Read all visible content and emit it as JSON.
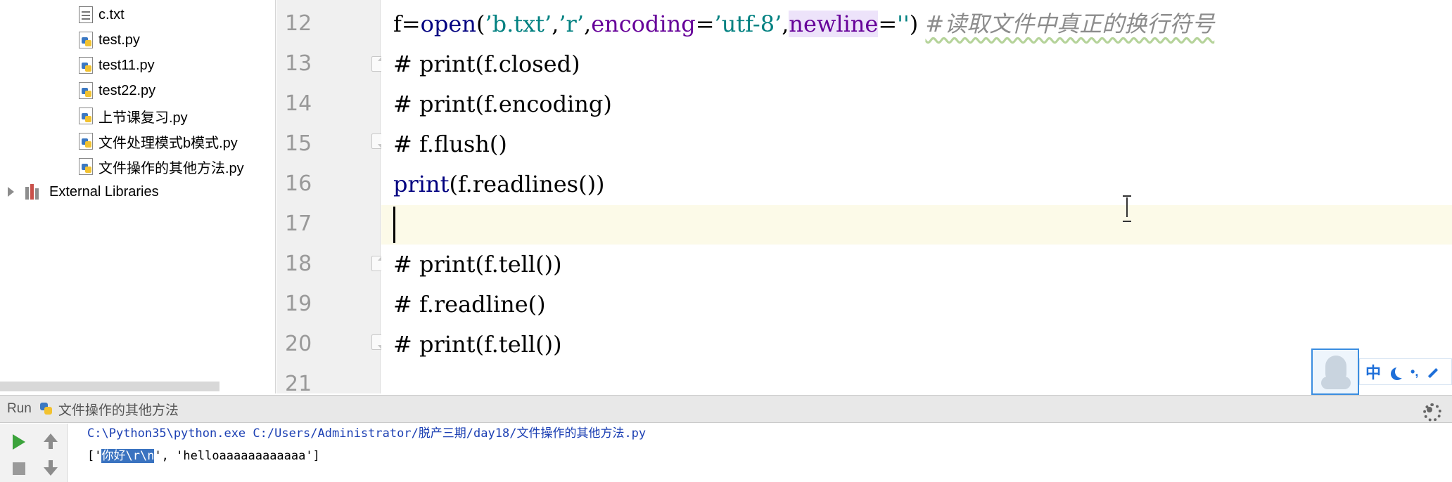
{
  "project_tree": {
    "files": [
      {
        "name": "c.txt",
        "type": "txt"
      },
      {
        "name": "test.py",
        "type": "py"
      },
      {
        "name": "test11.py",
        "type": "py"
      },
      {
        "name": "test22.py",
        "type": "py"
      },
      {
        "name": "上节课复习.py",
        "type": "py"
      },
      {
        "name": "文件处理模式b模式.py",
        "type": "py"
      },
      {
        "name": "文件操作的其他方法.py",
        "type": "py"
      }
    ],
    "external_libraries": "External Libraries"
  },
  "editor": {
    "line_numbers": [
      "12",
      "13",
      "14",
      "15",
      "16",
      "17",
      "18",
      "19",
      "20",
      "21"
    ],
    "current_line": "17",
    "lines": {
      "l12": {
        "f_eq": "f=",
        "open": "open",
        "p1": "(",
        "s1": "’b.txt’",
        "c1": ",",
        "s2": "’r’",
        "c2": ",",
        "kw1": "encoding",
        "eq1": "=",
        "s3": "’utf-8’",
        "c3": ",",
        "kw2": "newline",
        "eq2": "=",
        "s4": "''",
        "p2": ")",
        "comment": "#读取文件中真正的换行符号"
      },
      "l13": "# print(f.closed)",
      "l14": "# print(f.encoding)",
      "l15": "# f.flush()",
      "l16": {
        "print": "print",
        "rest": "(f.readlines())"
      },
      "l18": "# print(f.tell())",
      "l19": "# f.readline()",
      "l20": "# print(f.tell())"
    }
  },
  "ime": {
    "mode_label": "中",
    "dots": "•,"
  },
  "run_panel": {
    "title": "Run",
    "config_name": "文件操作的其他方法",
    "command": "C:\\Python35\\python.exe C:/Users/Administrator/脱产三期/day18/文件操作的其他方法.py",
    "output": {
      "prefix": "['",
      "selected": "你好\\r\\n",
      "suffix": "', 'helloaaaaaaaaaaaa']"
    }
  }
}
